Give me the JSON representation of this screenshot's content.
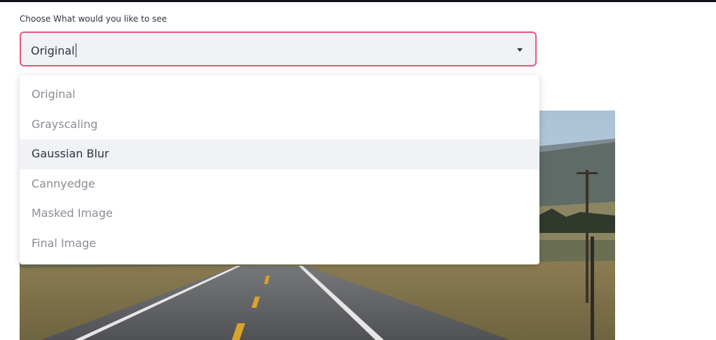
{
  "widget": {
    "label": "Choose What would you like to see",
    "selected_value": "Original",
    "chevron_icon": "chevron-down-icon"
  },
  "dropdown": {
    "highlighted_index": 2,
    "options": [
      {
        "label": "Original"
      },
      {
        "label": "Grayscaling"
      },
      {
        "label": "Gaussian Blur"
      },
      {
        "label": "Cannyedge"
      },
      {
        "label": "Masked Image"
      },
      {
        "label": "Final Image"
      }
    ]
  },
  "colors": {
    "accent_border": "#e8587a",
    "select_bg": "#f0f2f6",
    "text": "#31333f",
    "option_muted": "#8a8d96"
  }
}
